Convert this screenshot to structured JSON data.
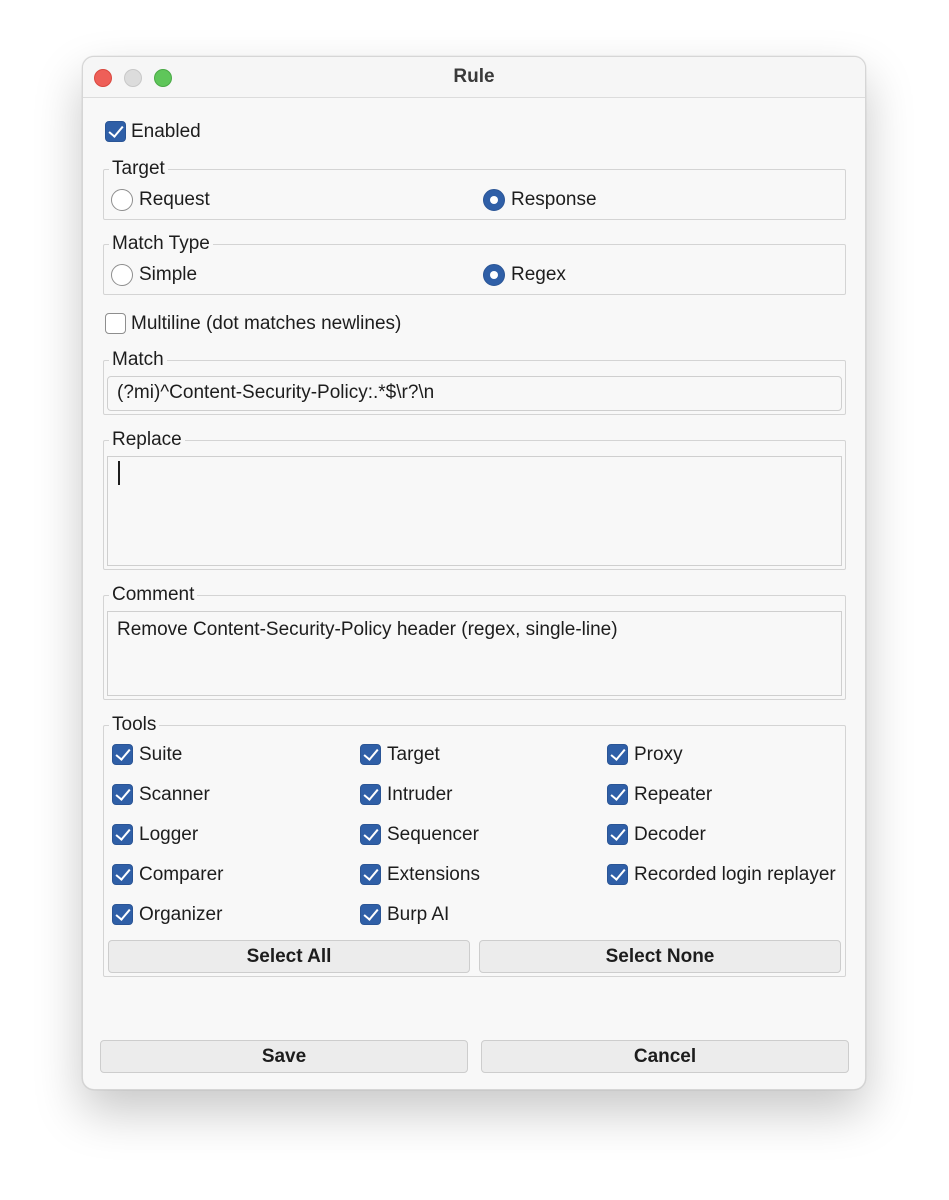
{
  "window": {
    "title": "Rule"
  },
  "enabled": {
    "label": "Enabled",
    "checked": true
  },
  "target": {
    "legend": "Target",
    "options": [
      {
        "label": "Request",
        "selected": false
      },
      {
        "label": "Response",
        "selected": true
      }
    ]
  },
  "match_type": {
    "legend": "Match Type",
    "options": [
      {
        "label": "Simple",
        "selected": false
      },
      {
        "label": "Regex",
        "selected": true
      }
    ]
  },
  "multiline": {
    "label": "Multiline (dot matches newlines)",
    "checked": false
  },
  "match": {
    "legend": "Match",
    "value": "(?mi)^Content-Security-Policy:.*$\\r?\\n"
  },
  "replace": {
    "legend": "Replace",
    "value": ""
  },
  "comment": {
    "legend": "Comment",
    "value": "Remove Content-Security-Policy header (regex, single-line)"
  },
  "tools": {
    "legend": "Tools",
    "items": [
      {
        "label": "Suite",
        "checked": true
      },
      {
        "label": "Target",
        "checked": true
      },
      {
        "label": "Proxy",
        "checked": true
      },
      {
        "label": "Scanner",
        "checked": true
      },
      {
        "label": "Intruder",
        "checked": true
      },
      {
        "label": "Repeater",
        "checked": true
      },
      {
        "label": "Logger",
        "checked": true
      },
      {
        "label": "Sequencer",
        "checked": true
      },
      {
        "label": "Decoder",
        "checked": true
      },
      {
        "label": "Comparer",
        "checked": true
      },
      {
        "label": "Extensions",
        "checked": true
      },
      {
        "label": "Recorded login replayer",
        "checked": true
      },
      {
        "label": "Organizer",
        "checked": true
      },
      {
        "label": "Burp AI",
        "checked": true
      }
    ],
    "select_all_label": "Select All",
    "select_none_label": "Select None"
  },
  "footer": {
    "save_label": "Save",
    "cancel_label": "Cancel"
  },
  "colors": {
    "accent": "#2f5fa7",
    "close": "#ee5f58",
    "maximize": "#5fc65a"
  }
}
